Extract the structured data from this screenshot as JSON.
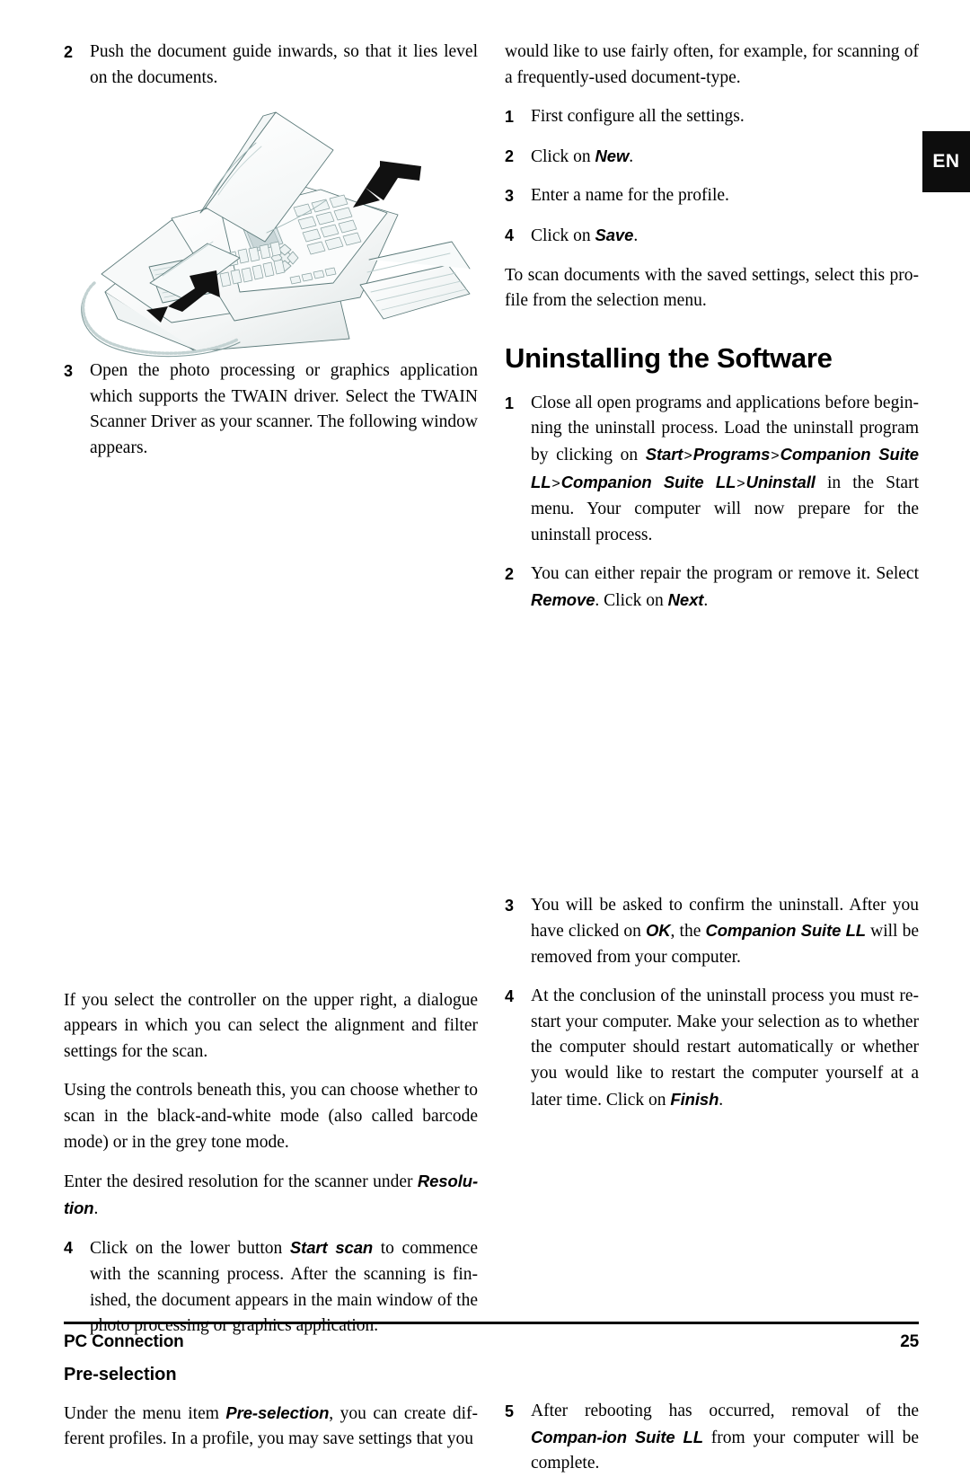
{
  "page": {
    "language_tab": "EN",
    "footer_title": "PC Connection",
    "footer_page_number": "25"
  },
  "left_column": {
    "step2": {
      "number": "2",
      "text": "Push the document guide inwards, so that it lies level on the documents."
    },
    "figure": {
      "alt": "Line drawing of a fax machine with document guide arrows",
      "arrow_1_label": "push-down-arrow",
      "arrow_2_label": "push-inward-arrow"
    },
    "step3": {
      "number": "3",
      "text": "Open the photo processing or graphics application which supports the TWAIN driver. Select the TWAIN Scanner Driver as your scanner. The following window appears."
    },
    "para_controller": "If you select the controller on the upper right, a dialogue appears in which you can select the alignment and filter settings for the scan.",
    "para_controls": "Using the controls beneath this, you can choose whether to scan in the black-and-white mode (also called barcode mode) or in the grey tone mode.",
    "para_resolution": {
      "before": "Enter the desired resolution for the scanner under ",
      "term": "Resolu-tion",
      "after": "."
    },
    "step4": {
      "number": "4",
      "before": "Click on the lower button ",
      "term": "Start scan",
      "after": " to commence with the scanning process. After the scanning is fin-ished, the document appears in the main window of the photo processing or graphics application."
    },
    "preselection_heading": "Pre-selection",
    "para_preselection": {
      "before": "Under the menu item ",
      "term": "Pre-selection",
      "after": ", you can create dif-ferent profiles. In a profile, you may save settings that you"
    }
  },
  "right_column": {
    "para_continued": "would like to use fairly often, for example, for scanning of a frequently-used document-type.",
    "profile_steps": [
      {
        "number": "1",
        "before": "First configure all the settings.",
        "term": "",
        "after": ""
      },
      {
        "number": "2",
        "before": "Click on ",
        "term": "New",
        "after": "."
      },
      {
        "number": "3",
        "before": "Enter a name for the profile.",
        "term": "",
        "after": ""
      },
      {
        "number": "4",
        "before": "Click on ",
        "term": "Save",
        "after": "."
      }
    ],
    "para_to_scan": "To scan documents with the saved settings, select this pro-file from the selection menu.",
    "section_heading": "Uninstalling the Software",
    "uninstall_step1": {
      "number": "1",
      "part_a": "Close all open programs and applications before begin-ning the uninstall process. Load the uninstall program by clicking on ",
      "term_start": "Start",
      "sep1": ">",
      "term_programs": "Programs",
      "sep2": ">",
      "term_companion": "Companion Suite LL",
      "sep3": ">",
      "term_companion2": "Companion Suite LL",
      "sep4": ">",
      "term_uninstall": "Uninstall",
      "part_b": " in the Start menu. Your computer will now prepare for the uninstall process."
    },
    "uninstall_step2": {
      "number": "2",
      "part_a": "You can either repair the program or remove it. Select ",
      "term_remove": "Remove",
      "part_b": ". Click on ",
      "term_next": "Next",
      "part_c": "."
    },
    "uninstall_step3": {
      "number": "3",
      "part_a": "You will be asked to confirm the uninstall. After you have clicked on ",
      "term_ok": "OK",
      "part_b": ", the ",
      "term_suite": "Companion Suite LL",
      "part_c": " will be removed from your computer."
    },
    "uninstall_step4": {
      "number": "4",
      "part_a": "At the conclusion of the uninstall process you must re-start your computer. Make your selection as to whether the computer should restart automatically or whether you would like to restart the computer yourself at a later time. Click on ",
      "term_finish": "Finish",
      "part_b": "."
    },
    "uninstall_step5": {
      "number": "5",
      "part_a": "After rebooting has occurred, removal of the ",
      "term_suite": "Compan-ion Suite LL",
      "part_b": " from your computer will be complete."
    }
  }
}
